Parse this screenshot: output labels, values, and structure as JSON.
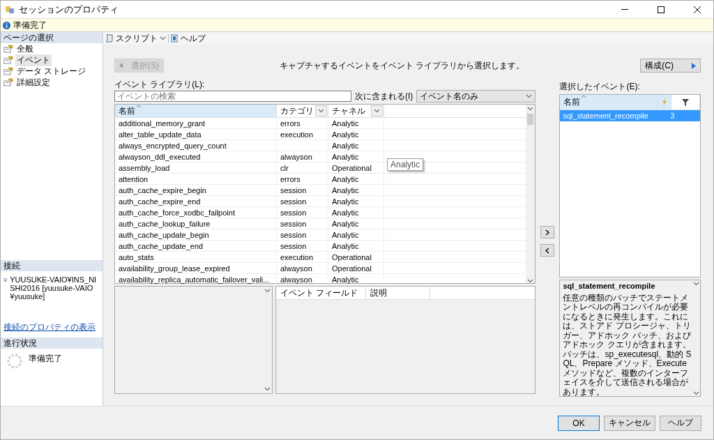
{
  "window": {
    "title": "セッションのプロパティ"
  },
  "info_bar": {
    "message": "準備完了"
  },
  "sidebar": {
    "pages_header": "ページの選択",
    "pages": [
      {
        "label": "全般",
        "selected": false
      },
      {
        "label": "イベント",
        "selected": true
      },
      {
        "label": "データ ストレージ",
        "selected": false
      },
      {
        "label": "詳細設定",
        "selected": false
      }
    ],
    "connection_header": "接続",
    "connection": "YUUSUKE-VAIO¥INS_NISHI2016 [yuusuke-VAIO¥yuusuke]",
    "connection_link": "接続のプロパティの表示",
    "progress_header": "進行状況",
    "progress_status": "準備完了"
  },
  "toolbar": {
    "script": "スクリプト",
    "help": "ヘルプ"
  },
  "select_button": {
    "label": "選択(S)",
    "disabled": true
  },
  "instruction": "キャプチャするイベントをイベント ライブラリから選択します。",
  "configure_button": {
    "label": "構成(C)",
    "disabled": false
  },
  "library_label": "イベント ライブラリ(L):",
  "search": {
    "placeholder": "イベントの検索"
  },
  "search_scope_label": "次に含まれる(I)",
  "search_scope": "イベント名のみ",
  "event_table": {
    "columns": [
      "名前",
      "カテゴリ",
      "チャネル"
    ],
    "rows": [
      {
        "name": "additional_memory_grant",
        "category": "errors",
        "channel": "Analytic"
      },
      {
        "name": "alter_table_update_data",
        "category": "execution",
        "channel": "Analytic"
      },
      {
        "name": "always_encrypted_query_count",
        "category": "",
        "channel": "Analytic"
      },
      {
        "name": "alwayson_ddl_executed",
        "category": "alwayson",
        "channel": "Analytic"
      },
      {
        "name": "assembly_load",
        "category": "clr",
        "channel": "Operational"
      },
      {
        "name": "attention",
        "category": "errors",
        "channel": "Analytic"
      },
      {
        "name": "auth_cache_expire_begin",
        "category": "session",
        "channel": "Analytic"
      },
      {
        "name": "auth_cache_expire_end",
        "category": "session",
        "channel": "Analytic"
      },
      {
        "name": "auth_cache_force_xodbc_failpoint",
        "category": "session",
        "channel": "Analytic"
      },
      {
        "name": "auth_cache_lookup_failure",
        "category": "session",
        "channel": "Analytic"
      },
      {
        "name": "auth_cache_update_begin",
        "category": "session",
        "channel": "Analytic"
      },
      {
        "name": "auth_cache_update_end",
        "category": "session",
        "channel": "Analytic"
      },
      {
        "name": "auto_stats",
        "category": "execution",
        "channel": "Operational"
      },
      {
        "name": "availability_group_lease_expired",
        "category": "alwayson",
        "channel": "Operational"
      },
      {
        "name": "availability_replica_automatic_failover_vali...",
        "category": "alwayson",
        "channel": "Analytic"
      }
    ]
  },
  "tooltip": "Analytic",
  "field_table": {
    "columns": [
      "イベント フィールド",
      "説明"
    ]
  },
  "selected_label": "選択したイベント(E):",
  "selected_table": {
    "columns": [
      "名前"
    ],
    "rows": [
      {
        "name": "sql_statement_recompile",
        "count": "3",
        "selected": true
      }
    ]
  },
  "description": {
    "title": "sql_statement_recompile",
    "text": "任意の種類のバッチでステートメントレベルの再コンパイルが必要になるときに発生します。これには、ストアド プロシージャ、トリガー、アドホック バッチ、およびアドホック クエリが含まれます。バッチは、sp_executesql、動的 SQL、Prepare メソッド、Execute メソッドなど、複数のインターフェイスを介して送信される場合があります。"
  },
  "buttons": [
    "OK",
    "キャンセル",
    "ヘルプ"
  ]
}
